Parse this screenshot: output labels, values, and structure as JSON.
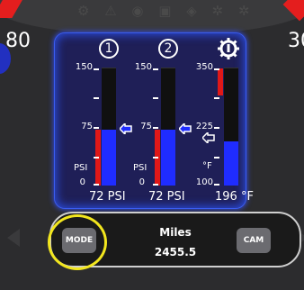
{
  "speed": {
    "left_num": "80",
    "right_num": "30"
  },
  "gauges": [
    {
      "id": "1",
      "header": "1",
      "ticks": [
        "150",
        "75",
        "0"
      ],
      "unit": "PSI",
      "readout": "72 PSI",
      "level": 0.48
    },
    {
      "id": "2",
      "header": "2",
      "ticks": [
        "150",
        "75",
        "0"
      ],
      "unit": "PSI",
      "readout": "72 PSI",
      "level": 0.48
    },
    {
      "id": "temp",
      "header": "",
      "ticks": [
        "350",
        "225",
        "100"
      ],
      "unit": "°F",
      "readout": "196 °F",
      "level": 0.38
    }
  ],
  "odometer": {
    "mode_label": "MODE",
    "cam_label": "CAM",
    "title": "Miles",
    "value": "2455.5"
  },
  "colors": {
    "panel": "#1f1f57",
    "fill": "#1f2cff",
    "warn": "#e01818",
    "highlight": "#f2e61e"
  }
}
